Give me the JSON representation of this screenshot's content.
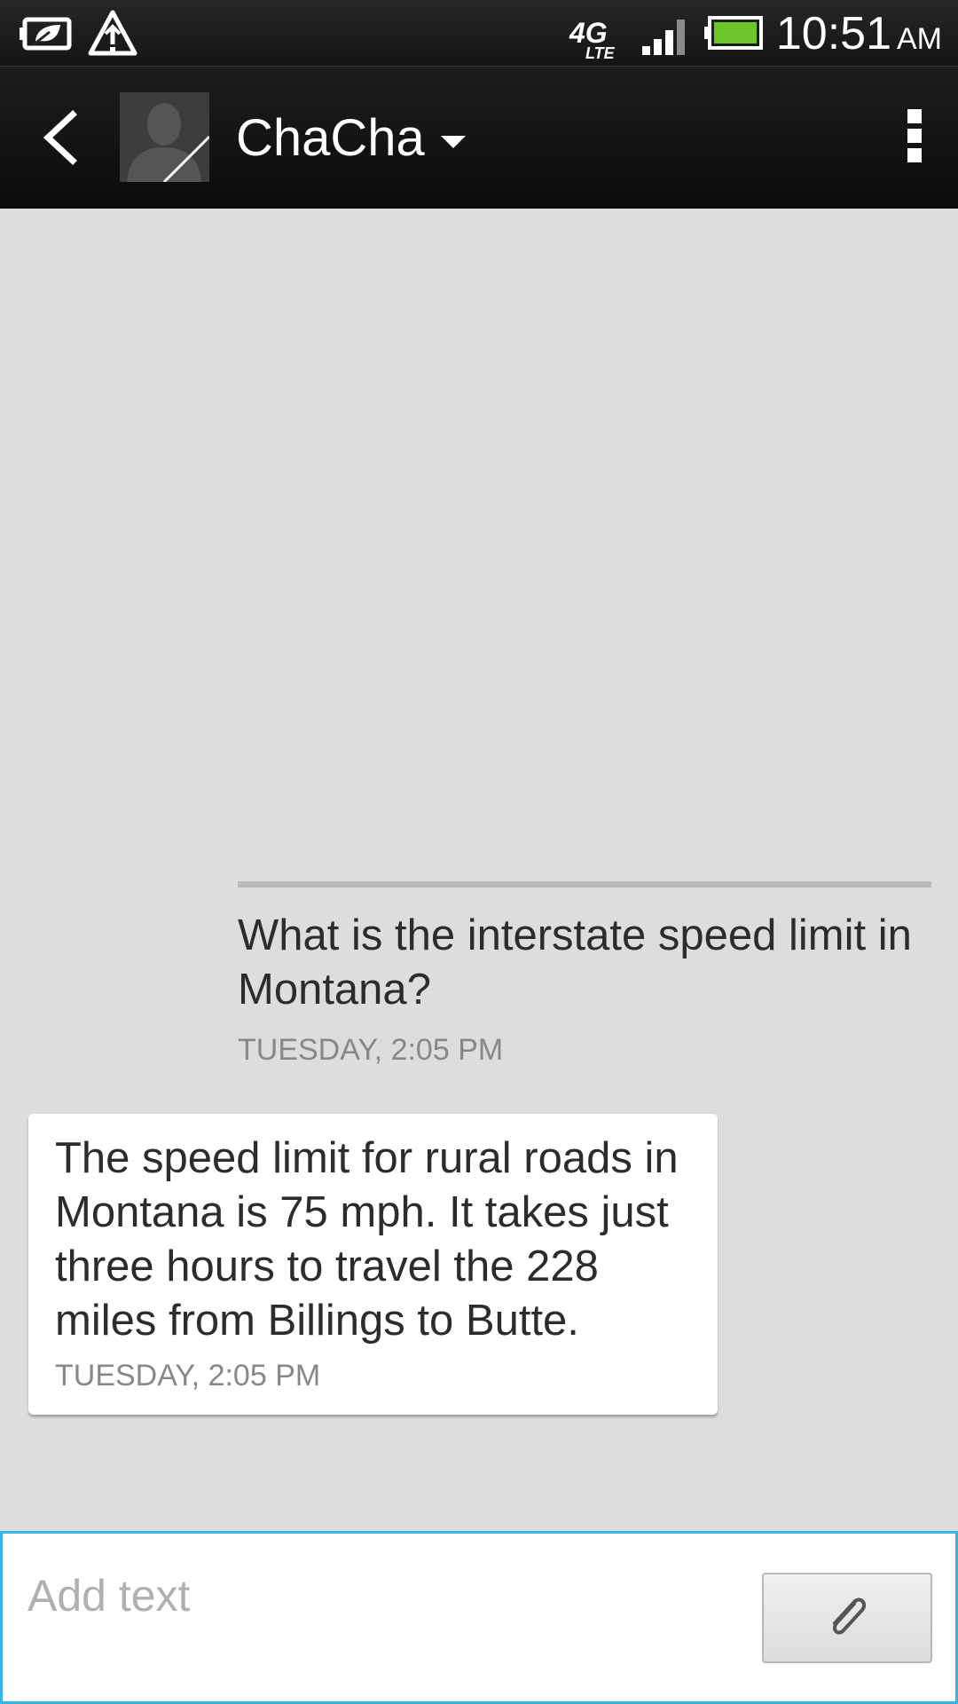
{
  "status_bar": {
    "time": "10:51",
    "ampm": "AM",
    "network_label": "4G LTE",
    "icons": [
      "power-saver-icon",
      "warning-icon",
      "4g-lte-icon",
      "signal-icon",
      "battery-icon"
    ],
    "battery_color": "#6cc52b"
  },
  "header": {
    "contact_name": "ChaCha",
    "icons": [
      "back-arrow-icon",
      "contact-avatar-icon",
      "dropdown-caret-icon",
      "overflow-menu-icon"
    ]
  },
  "conversation": {
    "messages": [
      {
        "direction": "sent",
        "text": "What is the interstate speed limit in Montana?",
        "timestamp": "TUESDAY, 2:05 PM"
      },
      {
        "direction": "received",
        "text": "The speed limit for rural roads in Montana is 75 mph. It takes just three hours to travel the 228 miles from Billings to Butte.",
        "timestamp": "TUESDAY, 2:05 PM"
      }
    ]
  },
  "compose": {
    "placeholder": "Add text",
    "value": "",
    "attach_icon": "paperclip-icon",
    "accent_color": "#33b5e5"
  }
}
